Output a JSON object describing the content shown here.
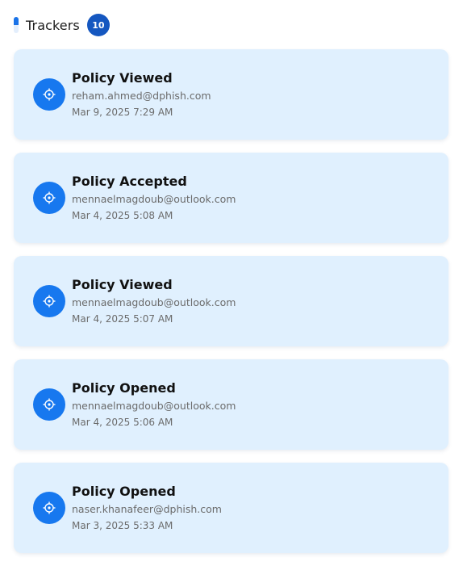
{
  "header": {
    "title": "Trackers",
    "count": "10"
  },
  "trackers": [
    {
      "title": "Policy Viewed",
      "email": "reham.ahmed@dphish.com",
      "time": "Mar 9, 2025 7:29 AM",
      "icon": "target-icon"
    },
    {
      "title": "Policy Accepted",
      "email": "mennaelmagdoub@outlook.com",
      "time": "Mar 4, 2025 5:08 AM",
      "icon": "target-icon"
    },
    {
      "title": "Policy Viewed",
      "email": "mennaelmagdoub@outlook.com",
      "time": "Mar 4, 2025 5:07 AM",
      "icon": "target-icon"
    },
    {
      "title": "Policy Opened",
      "email": "mennaelmagdoub@outlook.com",
      "time": "Mar 4, 2025 5:06 AM",
      "icon": "target-icon"
    },
    {
      "title": "Policy Opened",
      "email": "naser.khanafeer@dphish.com",
      "time": "Mar 3, 2025 5:33 AM",
      "icon": "target-icon"
    }
  ],
  "colors": {
    "accent": "#1778ef",
    "badge": "#1557c0",
    "card_background": "#e0f0fe",
    "secondary_text": "#6b6b6b"
  }
}
